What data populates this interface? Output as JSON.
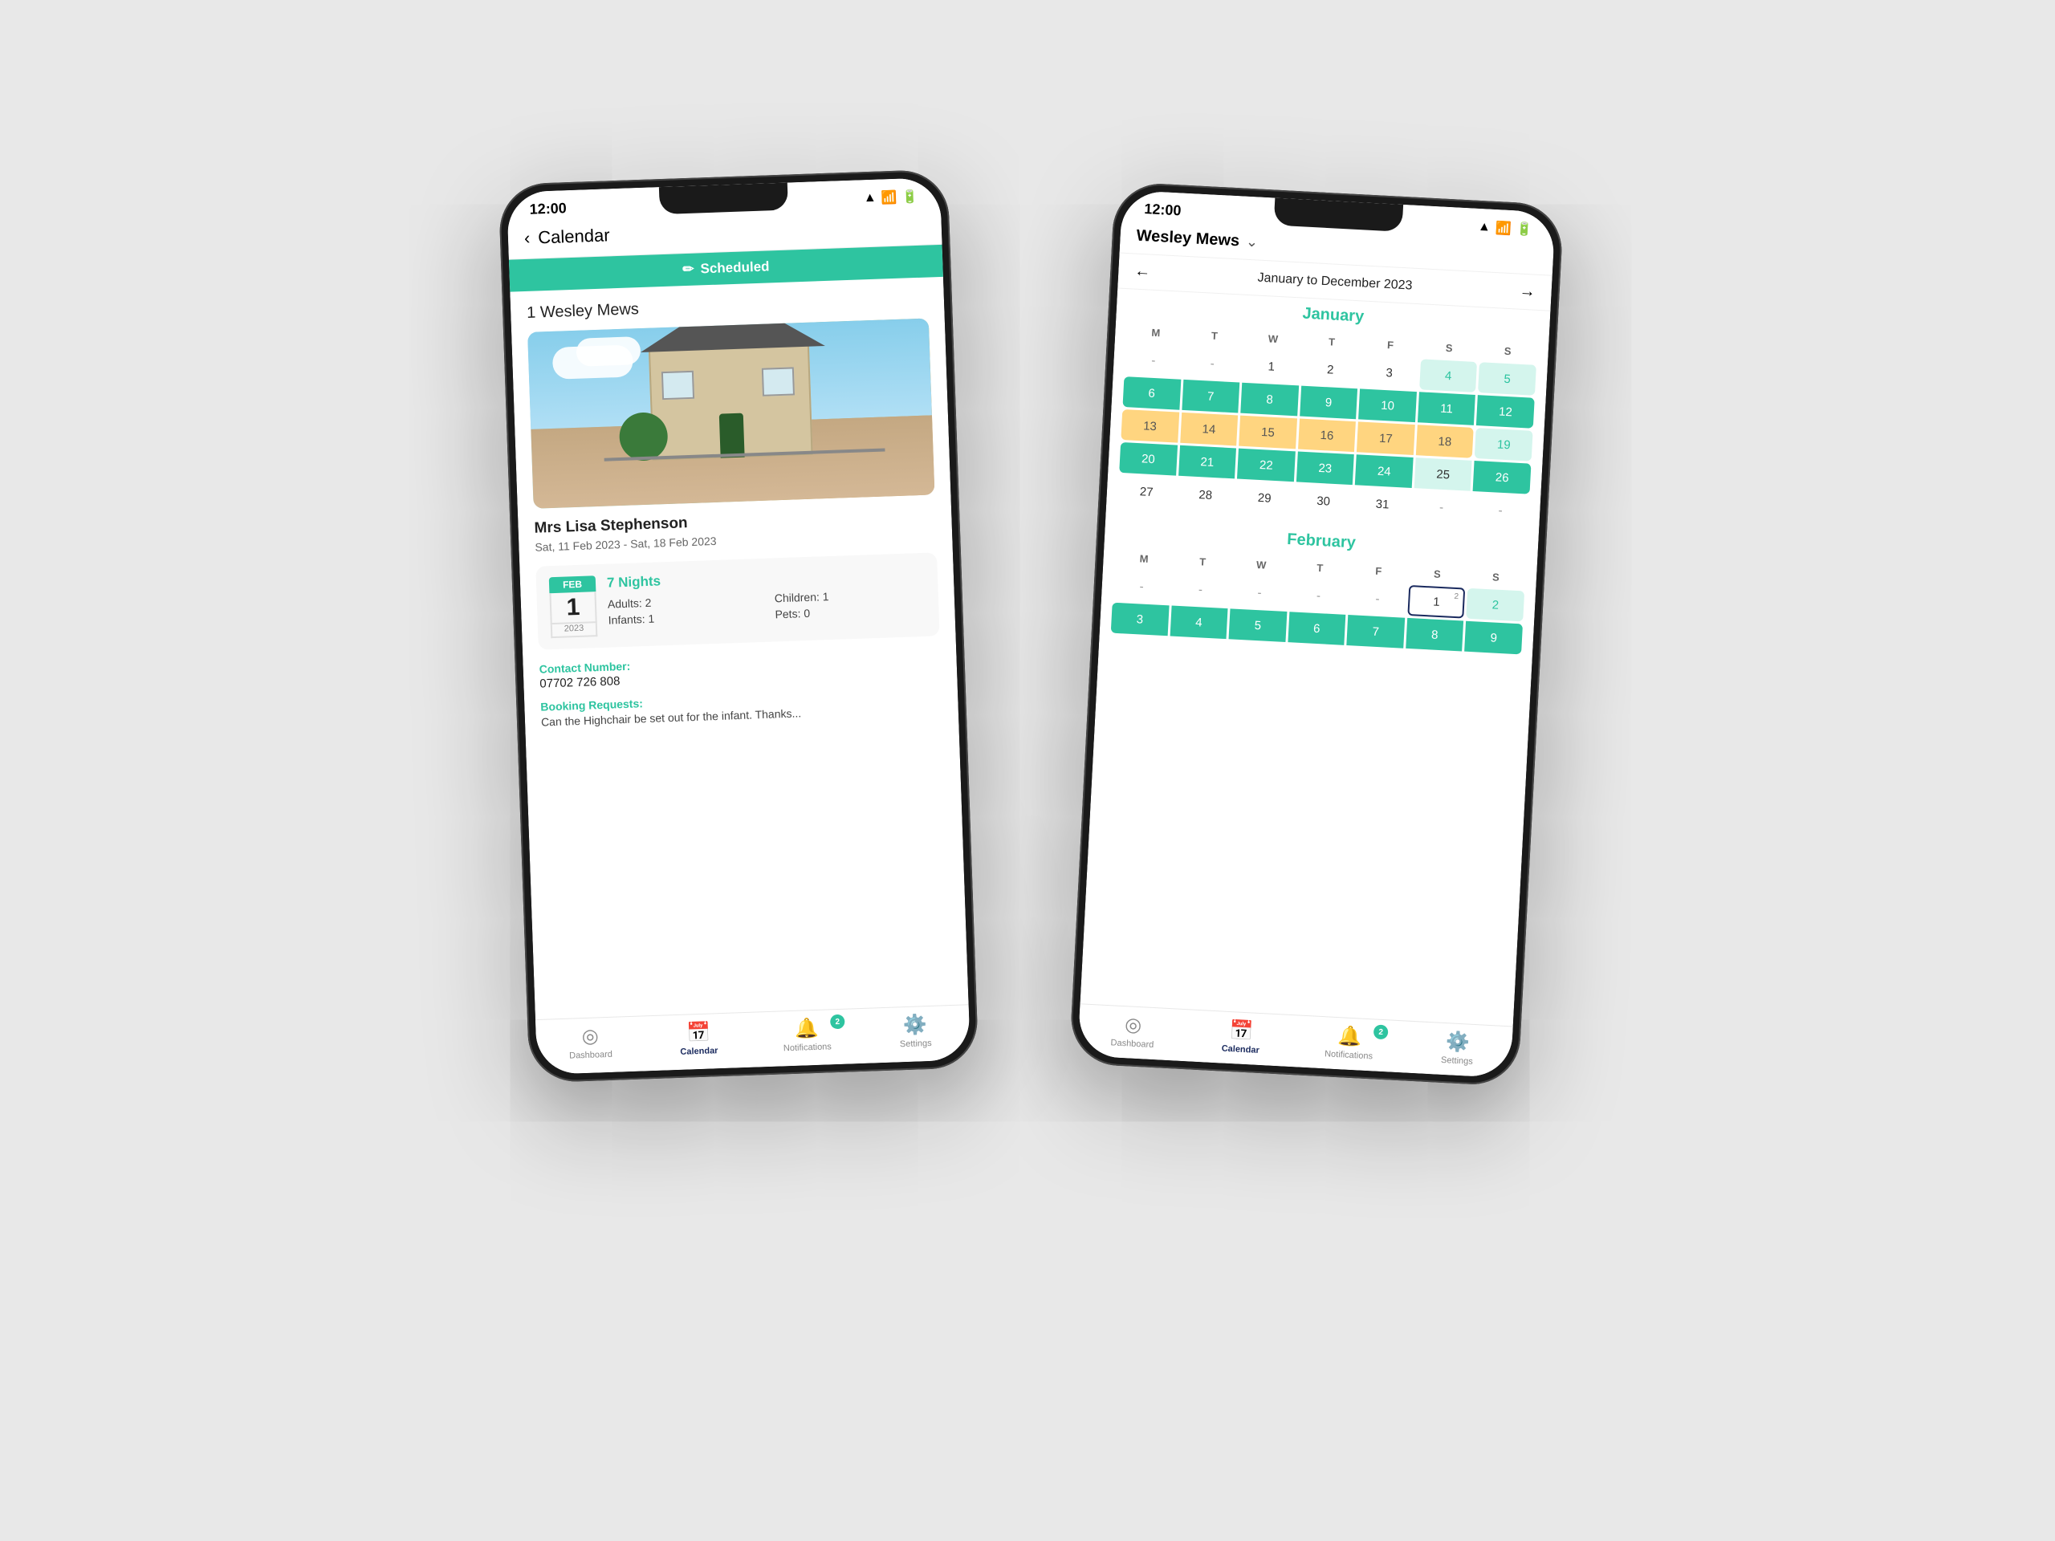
{
  "background": "#e8e8e8",
  "front_phone": {
    "status_time": "12:00",
    "header_back": "‹",
    "header_title": "Calendar",
    "scheduled_label": "Scheduled",
    "property_name": "1 Wesley Mews",
    "guest_name": "Mrs Lisa Stephenson",
    "booking_dates": "Sat, 11 Feb 2023 - Sat, 18 Feb 2023",
    "nights": "7 Nights",
    "date_badge_month": "FEB",
    "date_badge_day": "1",
    "date_badge_year": "2023",
    "adults": "Adults: 2",
    "children": "Children: 1",
    "infants": "Infants: 1",
    "pets": "Pets: 0",
    "contact_label": "Contact Number:",
    "contact_number": "07702 726 808",
    "requests_label": "Booking Requests:",
    "requests_text": "Can the Highchair be set out for the infant. Thanks...",
    "nav": {
      "dashboard": "Dashboard",
      "calendar": "Calendar",
      "notifications": "Notifications",
      "settings": "Settings",
      "notification_badge": "2"
    }
  },
  "back_phone": {
    "status_time": "12:00",
    "property_name": "Wesley Mews",
    "date_range": "January to December 2023",
    "january_title": "January",
    "february_title": "February",
    "day_headers": [
      "M",
      "T",
      "W",
      "T",
      "F",
      "S",
      "S"
    ],
    "january_rows": [
      [
        "-",
        "-",
        "1",
        "2",
        "3",
        "4",
        "5"
      ],
      [
        "6",
        "7",
        "8",
        "9",
        "10",
        "11",
        "12"
      ],
      [
        "13",
        "14",
        "15",
        "16",
        "17",
        "18",
        "19"
      ],
      [
        "20",
        "21",
        "22",
        "23",
        "24",
        "25",
        "26"
      ],
      [
        "27",
        "28",
        "29",
        "30",
        "31",
        "-",
        "-"
      ]
    ],
    "february_rows": [
      [
        "-",
        "-",
        "-",
        "-",
        "-",
        "1",
        "2"
      ],
      [
        "3",
        "4",
        "5",
        "6",
        "7",
        "8",
        "9"
      ]
    ],
    "nav": {
      "dashboard": "Dashboard",
      "calendar": "Calendar",
      "notifications": "Notifications",
      "settings": "Settings",
      "notification_badge": "2"
    }
  }
}
